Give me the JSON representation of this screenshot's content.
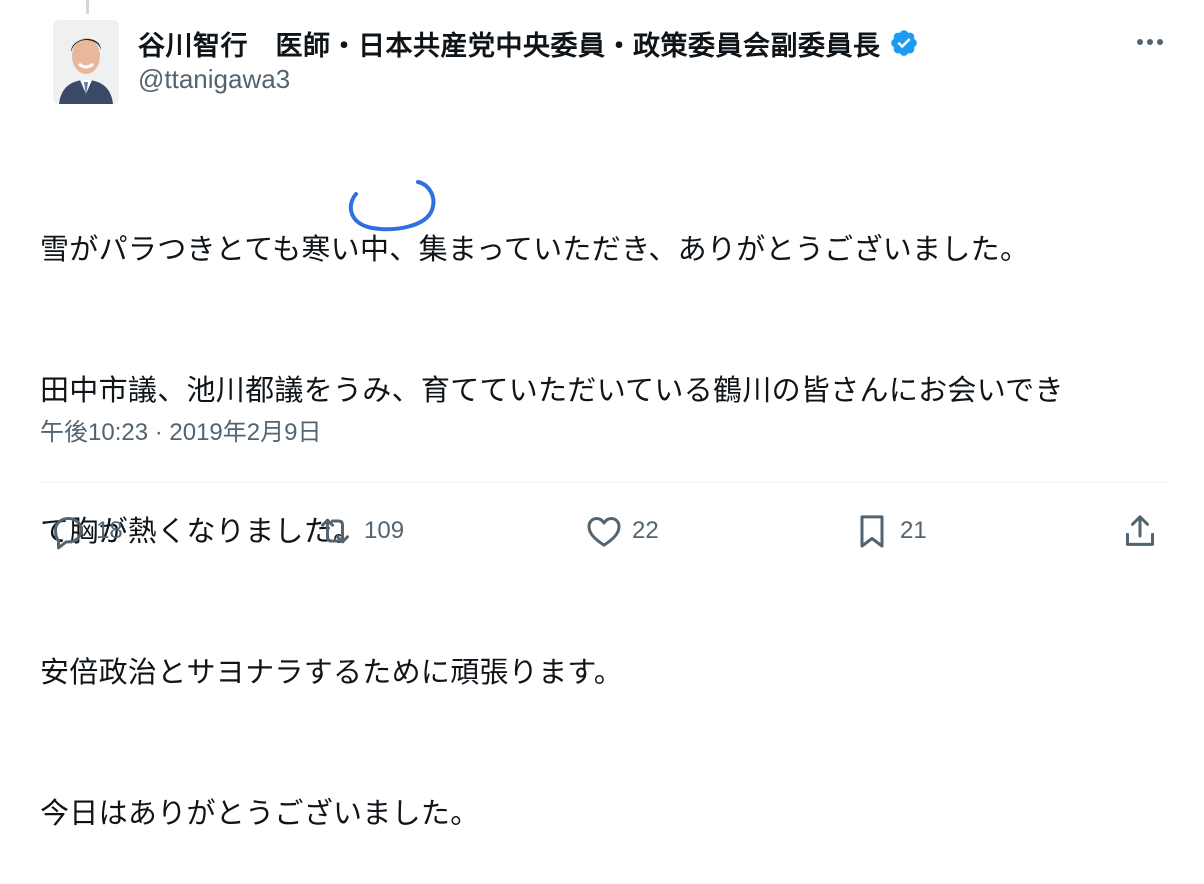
{
  "tweet": {
    "display_name": "谷川智行　医師・日本共産党中央委員・政策委員会副委員長",
    "handle": "@ttanigawa3",
    "lines": [
      "雪がパラつきとても寒い中、集まっていただき、ありがとうございました。",
      "田中市議、池川都議をうみ、育てていただいている鶴川の皆さんにお会いでき",
      "て胸が熱くなりました。",
      "安倍政治とサヨナラするために頑張ります。",
      "今日はありがとうございました。"
    ],
    "timestamp": "午後10:23 · 2019年2月9日"
  },
  "actions": {
    "replies": "18",
    "reposts": "109",
    "likes": "22",
    "bookmarks": "21"
  },
  "colors": {
    "verified": "#1d9bf0",
    "secondary_text": "#536471",
    "annotation_circle": "#2f6fe0"
  },
  "icons": [
    "verified-badge-icon",
    "more-options-icon",
    "reply-icon",
    "repost-icon",
    "like-icon",
    "bookmark-icon",
    "share-icon"
  ]
}
